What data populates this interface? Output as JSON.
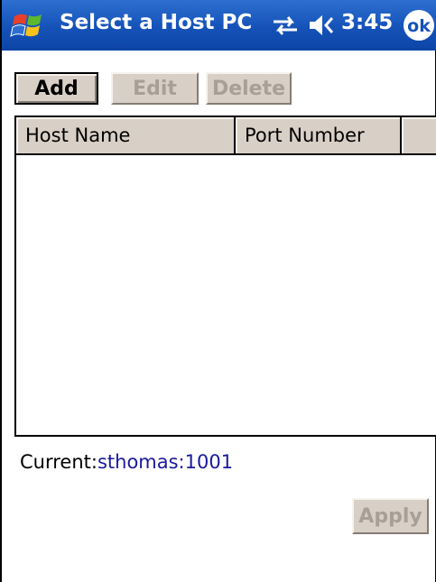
{
  "titlebar": {
    "title": "Select a Host PC",
    "time": "3:45",
    "ok_label": "ok",
    "start_icon": "windows-flag-icon",
    "connectivity_icon": "connectivity-icon",
    "volume_icon": "volume-icon",
    "color": "#1552b8"
  },
  "toolbar": {
    "add_label": "Add",
    "edit_label": "Edit",
    "delete_label": "Delete"
  },
  "hosts_list": {
    "columns": [
      "Host Name",
      "Port Number"
    ],
    "rows": []
  },
  "current": {
    "label": "Current:",
    "value": "sthomas:1001"
  },
  "apply_label": "Apply",
  "colors": {
    "button_face": "#d8cfc6",
    "disabled_text": "#a89f96",
    "link_text": "#1a1a9c"
  }
}
